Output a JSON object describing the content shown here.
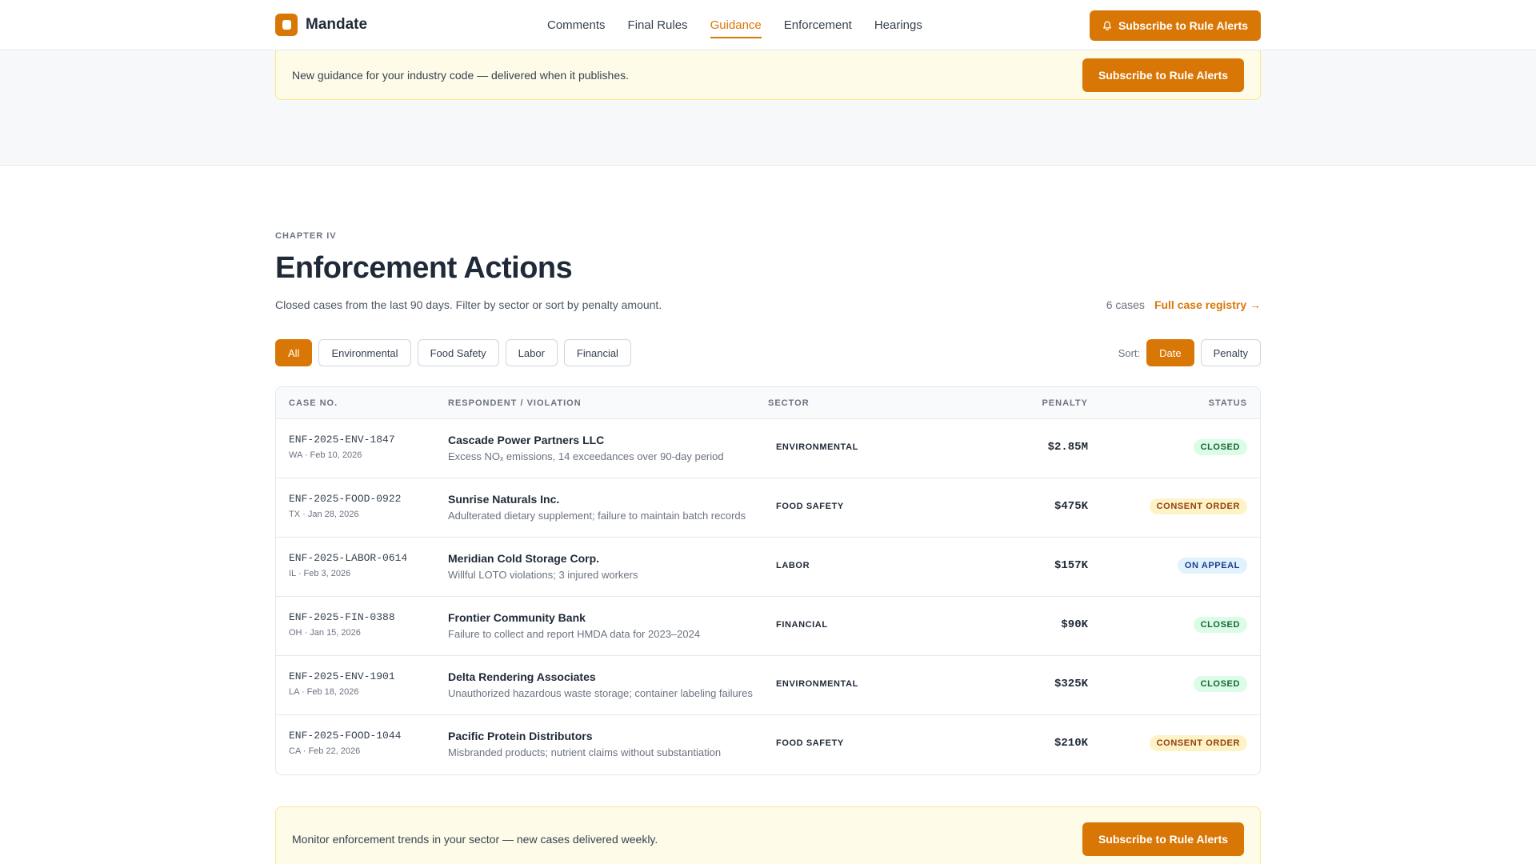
{
  "header": {
    "brand": "Mandate",
    "nav": [
      "Comments",
      "Final Rules",
      "Guidance",
      "Enforcement",
      "Hearings"
    ],
    "active_nav": "Guidance",
    "cta": "Subscribe to Rule Alerts"
  },
  "top_banner": {
    "text": "New guidance for your industry code — delivered when it publishes.",
    "cta": "Subscribe to Rule Alerts"
  },
  "section": {
    "eyebrow": "CHAPTER IV",
    "title": "Enforcement Actions",
    "subtitle": "Closed cases from the last 90 days. Filter by sector or sort by penalty amount.",
    "case_count": "6 cases",
    "registry_link": "Full case registry →"
  },
  "filters": [
    "All",
    "Environmental",
    "Food Safety",
    "Labor",
    "Financial"
  ],
  "active_filter": "All",
  "sort": {
    "label": "Sort:",
    "options": [
      "Date",
      "Penalty"
    ],
    "active": "Date"
  },
  "table": {
    "headers": [
      "CASE NO.",
      "RESPONDENT / VIOLATION",
      "SECTOR",
      "PENALTY",
      "STATUS"
    ],
    "rows": [
      {
        "case_no": "ENF-2025-ENV-1847",
        "meta": "WA · Feb 10, 2026",
        "respondent": "Cascade Power Partners LLC",
        "violation": "Excess NOₓ emissions, 14 exceedances over 90-day period",
        "sector": "ENVIRONMENTAL",
        "penalty": "$2.85M",
        "status": "CLOSED",
        "status_kind": "closed"
      },
      {
        "case_no": "ENF-2025-FOOD-0922",
        "meta": "TX · Jan 28, 2026",
        "respondent": "Sunrise Naturals Inc.",
        "violation": "Adulterated dietary supplement; failure to maintain batch records",
        "sector": "FOOD SAFETY",
        "penalty": "$475K",
        "status": "CONSENT ORDER",
        "status_kind": "consent"
      },
      {
        "case_no": "ENF-2025-LABOR-0614",
        "meta": "IL · Feb 3, 2026",
        "respondent": "Meridian Cold Storage Corp.",
        "violation": "Willful LOTO violations; 3 injured workers",
        "sector": "LABOR",
        "penalty": "$157K",
        "status": "ON APPEAL",
        "status_kind": "appeal"
      },
      {
        "case_no": "ENF-2025-FIN-0388",
        "meta": "OH · Jan 15, 2026",
        "respondent": "Frontier Community Bank",
        "violation": "Failure to collect and report HMDA data for 2023–2024",
        "sector": "FINANCIAL",
        "penalty": "$90K",
        "status": "CLOSED",
        "status_kind": "closed"
      },
      {
        "case_no": "ENF-2025-ENV-1901",
        "meta": "LA · Feb 18, 2026",
        "respondent": "Delta Rendering Associates",
        "violation": "Unauthorized hazardous waste storage; container labeling failures",
        "sector": "ENVIRONMENTAL",
        "penalty": "$325K",
        "status": "CLOSED",
        "status_kind": "closed"
      },
      {
        "case_no": "ENF-2025-FOOD-1044",
        "meta": "CA · Feb 22, 2026",
        "respondent": "Pacific Protein Distributors",
        "violation": "Misbranded products; nutrient claims without substantiation",
        "sector": "FOOD SAFETY",
        "penalty": "$210K",
        "status": "CONSENT ORDER",
        "status_kind": "consent"
      }
    ]
  },
  "bottom_banner": {
    "text": "Monitor enforcement trends in your sector — new cases delivered weekly.",
    "cta": "Subscribe to Rule Alerts"
  },
  "colors": {
    "accent": "#d97706",
    "banner_bg": "#fefce8",
    "closed": "#166534",
    "consent": "#92400e",
    "appeal": "#1e3a8a"
  }
}
